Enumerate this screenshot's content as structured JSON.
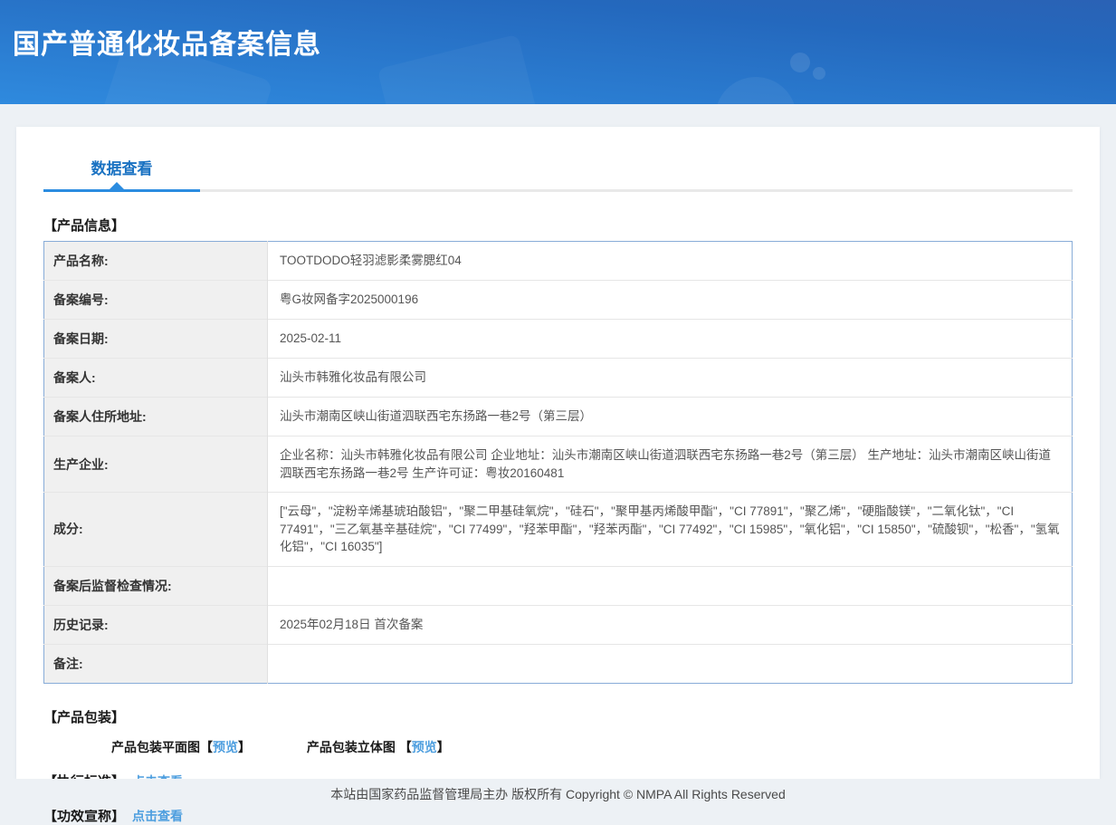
{
  "header": {
    "title": "国产普通化妆品备案信息"
  },
  "tabs": {
    "data_view": "数据查看"
  },
  "product_info": {
    "section_title": "【产品信息】",
    "rows": [
      {
        "label": "产品名称:",
        "value": "TOOTDODO轻羽滤影柔雾腮红04"
      },
      {
        "label": "备案编号:",
        "value": "粤G妆网备字2025000196"
      },
      {
        "label": "备案日期:",
        "value": "2025-02-11"
      },
      {
        "label": "备案人:",
        "value": "汕头市韩雅化妆品有限公司"
      },
      {
        "label": "备案人住所地址:",
        "value": "汕头市潮南区峡山街道泗联西宅东扬路一巷2号（第三层）"
      },
      {
        "label": "生产企业:",
        "value": "企业名称：汕头市韩雅化妆品有限公司 企业地址：汕头市潮南区峡山街道泗联西宅东扬路一巷2号（第三层） 生产地址：汕头市潮南区峡山街道泗联西宅东扬路一巷2号 生产许可证：粤妆20160481"
      },
      {
        "label": "成分:",
        "value": "[\"云母\"，\"淀粉辛烯基琥珀酸铝\"，\"聚二甲基硅氧烷\"，\"硅石\"，\"聚甲基丙烯酸甲酯\"，\"CI 77891\"，\"聚乙烯\"，\"硬脂酸镁\"，\"二氧化钛\"，\"CI 77491\"，\"三乙氧基辛基硅烷\"，\"CI 77499\"，\"羟苯甲酯\"，\"羟苯丙酯\"，\"CI 77492\"，\"CI 15985\"，\"氧化铝\"，\"CI 15850\"，\"硫酸钡\"，\"松香\"，\"氢氧化铝\"，\"CI 16035\"]"
      },
      {
        "label": "备案后监督检查情况:",
        "value": ""
      },
      {
        "label": "历史记录:",
        "value": "2025年02月18日 首次备案"
      },
      {
        "label": "备注:",
        "value": ""
      }
    ]
  },
  "packaging": {
    "section_title": "【产品包装】",
    "flat_label": "产品包装平面图",
    "stereo_label": "产品包装立体图 ",
    "bracket_open": "【",
    "bracket_close": "】",
    "preview_link": "预览"
  },
  "standard": {
    "section_title": "【执行标准】",
    "link": "点击查看"
  },
  "efficacy": {
    "section_title": "【功效宣称】",
    "link": "点击查看"
  },
  "footer": {
    "text": "本站由国家药品监督管理局主办 版权所有 Copyright © NMPA All Rights Reserved"
  },
  "colors": {
    "accent_blue": "#1a72c2",
    "tab_underline_blue": "#2b8ce0",
    "link_blue": "#4d9edf",
    "header_gradient_light": "#2f8ade",
    "header_gradient_dark": "#2a62b5",
    "table_border": "#88acd8",
    "label_cell_bg": "#f0f0f0",
    "page_bg": "#edf1f5"
  }
}
